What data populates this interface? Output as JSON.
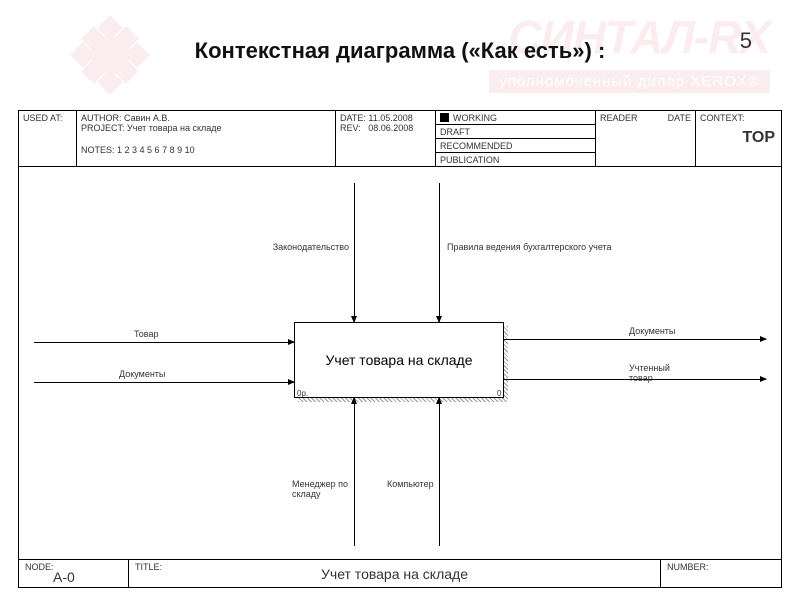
{
  "page_number": "5",
  "title": "Контекстная диаграмма («Как есть») :",
  "watermark": {
    "brand": "СИНТАЛ-RX",
    "subtitle": "уполномоченный дилер XEROX®"
  },
  "header": {
    "used_at_label": "USED AT:",
    "author_label": "AUTHOR:",
    "author": "Савин А.В.",
    "project_label": "PROJECT:",
    "project": "Учет товара на складе",
    "notes_label": "NOTES:",
    "notes": "1 2 3 4 5 6 7 8 9 10",
    "date_label": "DATE:",
    "date": "11.05.2008",
    "rev_label": "REV:",
    "rev": "08.06.2008",
    "status": {
      "working": "WORKING",
      "draft": "DRAFT",
      "recommended": "RECOMMENDED",
      "publication": "PUBLICATION"
    },
    "reader_label": "READER",
    "date2_label": "DATE",
    "context_label": "CONTEXT:",
    "context_value": "TOP"
  },
  "diagram": {
    "central": "Учет товара на складе",
    "central_corner_left": "0р.",
    "central_corner_right": "0",
    "controls": {
      "c1": "Законодательство",
      "c2": "Правила ведения бухгалтерского учета"
    },
    "inputs": {
      "i1": "Товар",
      "i2": "Документы"
    },
    "outputs": {
      "o1": "Документы",
      "o2": "Учтенный товар"
    },
    "mechanisms": {
      "m1": "Менеджер по складу",
      "m2": "Компьютер"
    }
  },
  "footer": {
    "node_label": "NODE:",
    "node": "A-0",
    "title_label": "TITLE:",
    "title": "Учет товара на складе",
    "number_label": "NUMBER:"
  }
}
